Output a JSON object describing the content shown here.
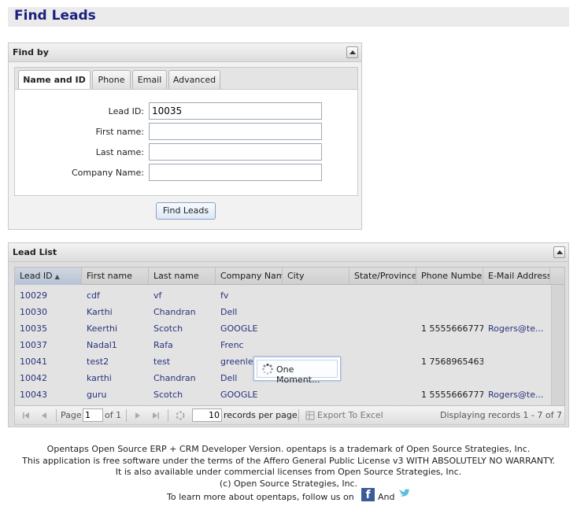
{
  "page": {
    "title": "Find Leads"
  },
  "find_by": {
    "title": "Find by",
    "tabs": [
      "Name and ID",
      "Phone",
      "Email",
      "Advanced"
    ],
    "fields": [
      {
        "label": "Lead ID:",
        "value": "10035"
      },
      {
        "label": "First name:",
        "value": ""
      },
      {
        "label": "Last name:",
        "value": ""
      },
      {
        "label": "Company Name:",
        "value": ""
      }
    ],
    "button": "Find Leads"
  },
  "lead_list": {
    "title": "Lead List",
    "columns": [
      "Lead ID",
      "First name",
      "Last name",
      "Company Name",
      "City",
      "State/Province",
      "Phone Number",
      "E-Mail Address"
    ],
    "rows": [
      [
        "10029",
        "cdf",
        "vf",
        "fv",
        "",
        "",
        "",
        ""
      ],
      [
        "10030",
        "Karthi",
        "Chandran",
        "Dell",
        "",
        "",
        "",
        ""
      ],
      [
        "10035",
        "Keerthi",
        "Scotch",
        "GOOGLE",
        "",
        "",
        "1 5555666777",
        "Rogers@te..."
      ],
      [
        "10037",
        "Nadal1",
        "Rafa",
        "Frenc",
        "",
        "",
        "",
        ""
      ],
      [
        "10041",
        "test2",
        "test",
        "greenle",
        "",
        "",
        "1 7568965463",
        ""
      ],
      [
        "10042",
        "karthi",
        "Chandran",
        "Dell",
        "",
        "",
        "",
        ""
      ],
      [
        "10043",
        "guru",
        "Scotch",
        "GOOGLE",
        "",
        "",
        "1 5555666777",
        "Rogers@te..."
      ]
    ],
    "loading_text": "One Moment...",
    "pager": {
      "page_label": "Page",
      "page_value": "1",
      "of_label": "of 1",
      "page_size": "10",
      "records_label": "records per page.",
      "export_label": "Export To Excel",
      "displaying": "Displaying records 1 - 7 of 7"
    }
  },
  "footer": {
    "lines": [
      "Opentaps Open Source ERP + CRM Developer Version. opentaps is a trademark of Open Source Strategies, Inc.",
      "This application is free software under the terms of the Affero General Public License v3 WITH ABSOLUTELY NO WARRANTY.",
      "It is also available under commercial licenses from Open Source Strategies, Inc.",
      "(c) Open Source Strategies, Inc."
    ],
    "follow_text": "To learn more about opentaps, follow us on",
    "and_text": "And",
    "facebook_letter": "f"
  },
  "colors": {
    "title": "#1a2080",
    "link": "#2d3a8c",
    "facebook": "#3b5a98",
    "twitter": "#5bc0de"
  }
}
